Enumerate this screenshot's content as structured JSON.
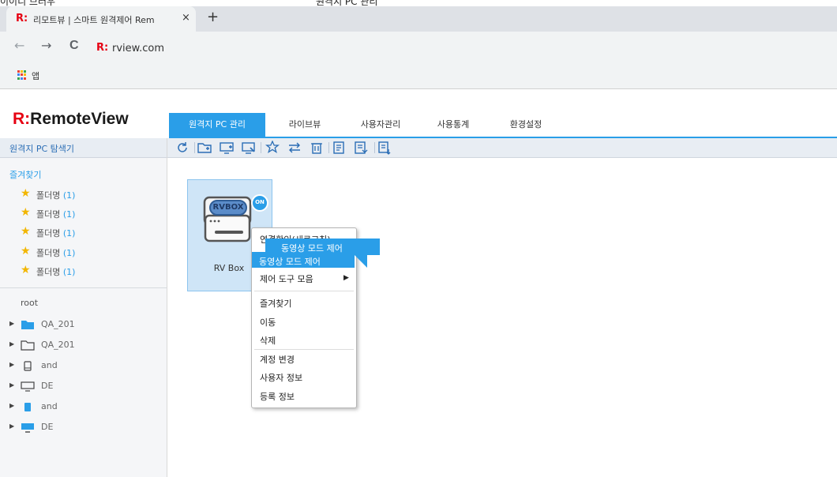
{
  "page_cut_text": [
    "이이디 브러우",
    "원격지 PC 관리"
  ],
  "browser": {
    "tab_title": "리모트뷰 | 스마트 원격제어 Rem",
    "tab_close": "×",
    "new_tab": "+",
    "favicon_glyph": "R:",
    "url": "rview.com",
    "back": "←",
    "forward": "→",
    "reload": "C",
    "apps_label": "앱"
  },
  "app": {
    "logo_mark": "R:",
    "logo_text": "RemoteView",
    "nav": [
      "원격지 PC 관리",
      "라이브뷰",
      "사용자관리",
      "사용통계",
      "환경설정"
    ],
    "active_nav": "원격지 PC 관리",
    "accent_color": "#2a9ee8",
    "brand_color": "#e60012"
  },
  "sidebar": {
    "header": "원격지 PC 탐색기",
    "favorites_title": "즐겨찾기",
    "favorites": [
      {
        "label": "폴더명",
        "count": "(1)"
      },
      {
        "label": "폴더명",
        "count": "(1)"
      },
      {
        "label": "폴더명",
        "count": "(1)"
      },
      {
        "label": "폴더명",
        "count": "(1)"
      },
      {
        "label": "폴더명",
        "count": "(1)"
      }
    ],
    "root": "root",
    "tree": [
      {
        "label": "QA_201",
        "icon": "folder-filled-icon"
      },
      {
        "label": "QA_201",
        "icon": "folder-outline-icon"
      },
      {
        "label": "and",
        "icon": "mobile-outline-icon"
      },
      {
        "label": "DE",
        "icon": "monitor-outline-icon"
      },
      {
        "label": "and",
        "icon": "mobile-filled-icon"
      },
      {
        "label": "DE",
        "icon": "monitor-filled-icon"
      }
    ]
  },
  "toolbar_icons": [
    "refresh-icon",
    "add-folder-icon",
    "add-pc-icon",
    "add-pc-alt-icon",
    "add-favorite-icon",
    "move-icon",
    "delete-icon",
    "log-icon",
    "export-icon",
    "import-icon"
  ],
  "device": {
    "badge_text": "RVBOX",
    "status": "ON",
    "name": "RV Box"
  },
  "context_menu": {
    "items": [
      "연결확인(새로고침)",
      "동영상 모드 제어",
      "제어 도구 모음",
      "즐겨찾기",
      "이동",
      "삭제",
      "계정 변경",
      "사용자 정보",
      "등록 정보"
    ],
    "submenu_arrow": "▶",
    "tooltip": "동영상 모드 제어"
  }
}
